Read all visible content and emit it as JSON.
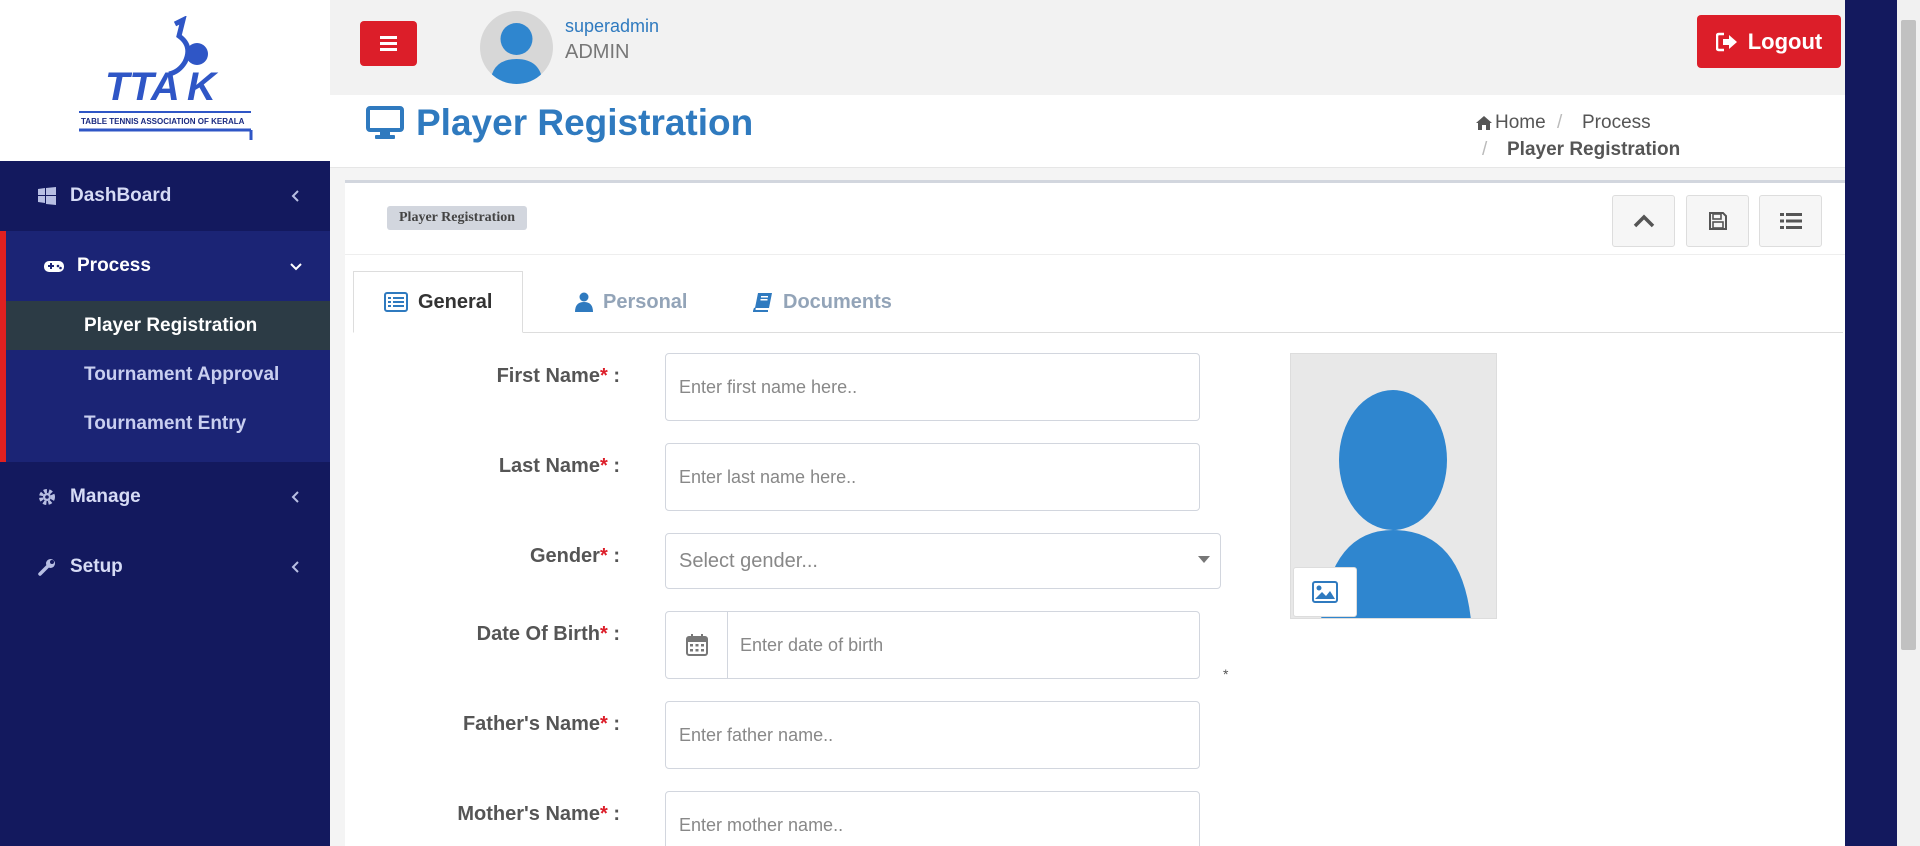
{
  "app": {
    "logo_text": "TTAK",
    "logo_subtitle": "TABLE TENNIS ASSOCIATION OF KERALA"
  },
  "sidebar": {
    "items": [
      {
        "label": "DashBoard",
        "icon": "windows-icon"
      },
      {
        "label": "Process",
        "icon": "gamepad-icon"
      },
      {
        "label": "Manage",
        "icon": "gear-icon"
      },
      {
        "label": "Setup",
        "icon": "wrench-icon"
      }
    ],
    "process_sub": [
      {
        "label": "Player Registration",
        "active": true
      },
      {
        "label": "Tournament Approval",
        "active": false
      },
      {
        "label": "Tournament Entry",
        "active": false
      }
    ]
  },
  "topbar": {
    "username": "superadmin",
    "role": "ADMIN",
    "logout_label": "Logout"
  },
  "header": {
    "title": "Player Registration",
    "breadcrumb": [
      "Home",
      "Process",
      "Player Registration"
    ],
    "separator": "/"
  },
  "card": {
    "badge": "Player Registration"
  },
  "tabs": [
    {
      "label": "General",
      "icon": "list-icon"
    },
    {
      "label": "Personal",
      "icon": "user-icon"
    },
    {
      "label": "Documents",
      "icon": "book-icon"
    }
  ],
  "form": {
    "required_mark": "*",
    "colon": ":",
    "first_name": {
      "label": "First Name",
      "placeholder": "Enter first name here.."
    },
    "last_name": {
      "label": "Last Name",
      "placeholder": "Enter last name here.."
    },
    "gender": {
      "label": "Gender",
      "placeholder": "Select gender..."
    },
    "dob": {
      "label": "Date Of Birth",
      "placeholder": "Enter date of birth"
    },
    "father_name": {
      "label": "Father's Name",
      "placeholder": "Enter father name.."
    },
    "mother_name": {
      "label": "Mother's Name",
      "placeholder": "Enter mother name.."
    }
  },
  "colors": {
    "sidebar_bg": "#13195e",
    "accent_red": "#dc1e29",
    "primary_blue": "#2f7abf"
  }
}
